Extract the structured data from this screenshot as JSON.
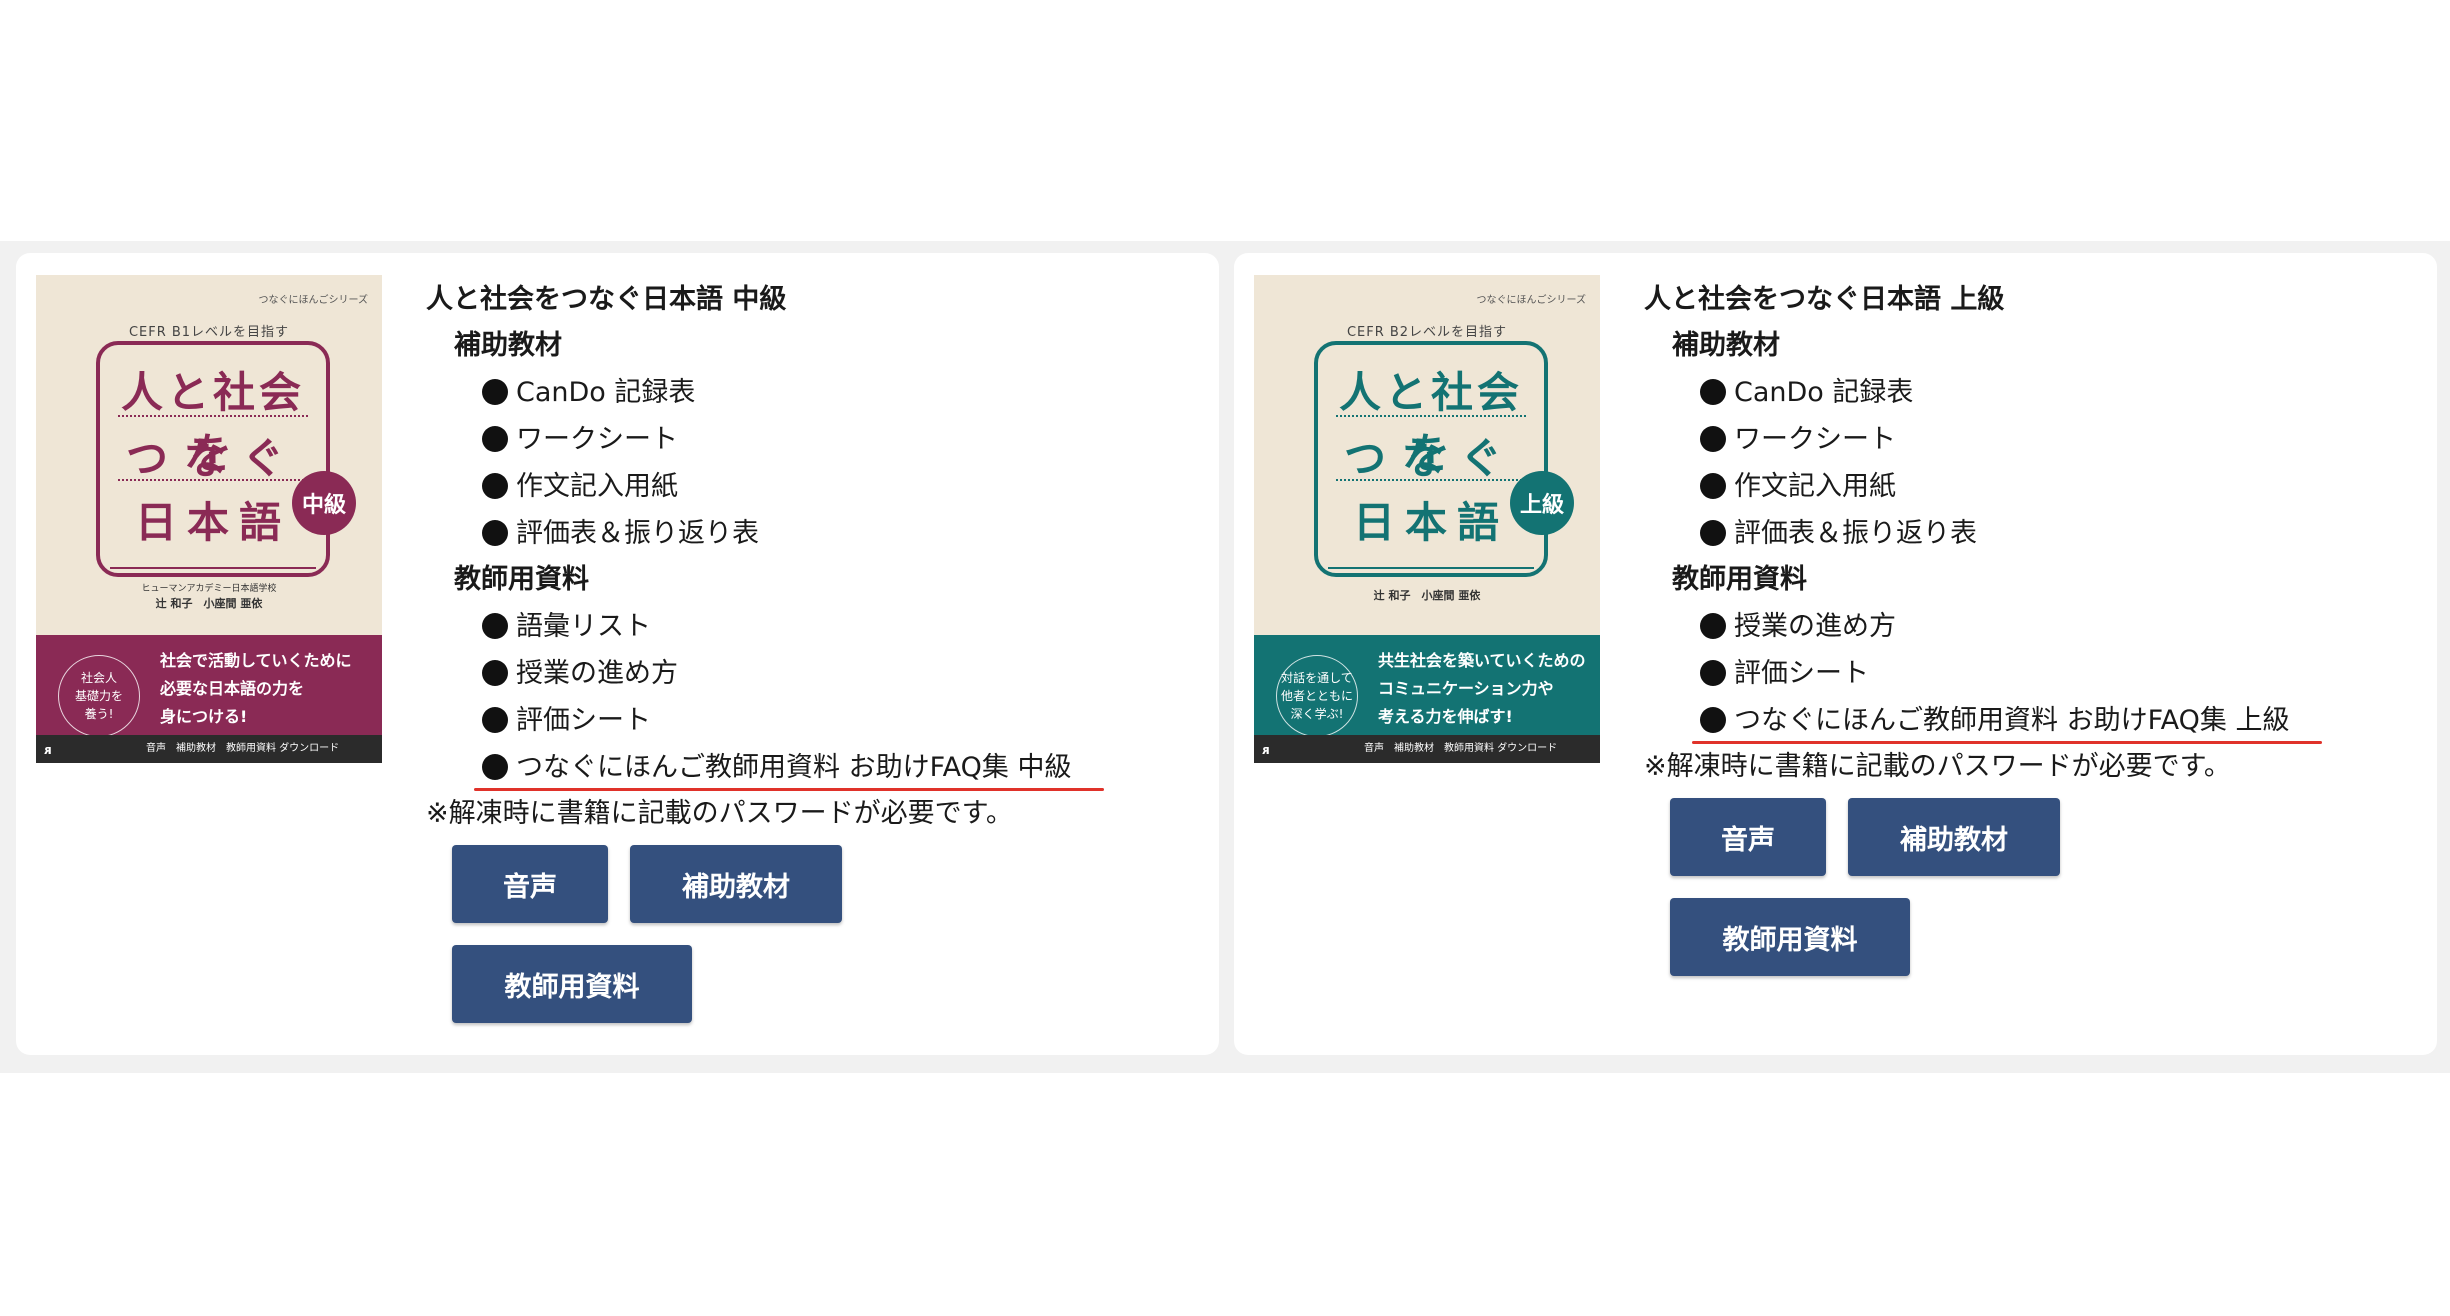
{
  "cards": [
    {
      "cover": {
        "series": "つなぐにほんごシリーズ",
        "cefr": "CEFR B1レベルを目指す",
        "title_line1": "人と社会を",
        "title_line2": "つなぐ",
        "title_line3": "日本語",
        "level_badge": "中級",
        "authors_org": "ヒューマンアカデミー日本語学校",
        "authors": "辻 和子　小座間 亜依",
        "circle_text": "社会人\n基礎力を\n養う!",
        "tagline": "社会で活動していくために\n必要な日本語の力を\n身につける!",
        "footer": "音声　補助教材　教師用資料 ダウンロード",
        "publisher": "ᴙ"
      },
      "title": "人と社会をつなぐ日本語 中級",
      "sections": [
        {
          "label": "補助教材",
          "items": [
            "CanDo 記録表",
            "ワークシート",
            "作文記入用紙",
            "評価表＆振り返り表"
          ]
        },
        {
          "label": "教師用資料",
          "items": [
            "語彙リスト",
            "授業の進め方",
            "評価シート",
            "つなぐにほんご教師用資料 お助けFAQ集 中級"
          ]
        }
      ],
      "note": "※解凍時に書籍に記載のパスワードが必要です。",
      "buttons": [
        "音声",
        "補助教材",
        "教師用資料"
      ]
    },
    {
      "cover": {
        "series": "つなぐにほんごシリーズ",
        "cefr": "CEFR B2レベルを目指す",
        "title_line1": "人と社会を",
        "title_line2": "つなぐ",
        "title_line3": "日本語",
        "level_badge": "上級",
        "authors_org": "",
        "authors": "辻 和子　小座間 亜依",
        "circle_text": "対話を通して\n他者とともに\n深く学ぶ!",
        "tagline": "共生社会を築いていくための\nコミュニケーション力や\n考える力を伸ばす!",
        "footer": "音声　補助教材　教師用資料 ダウンロード",
        "publisher": "ᴙ"
      },
      "title": "人と社会をつなぐ日本語 上級",
      "sections": [
        {
          "label": "補助教材",
          "items": [
            "CanDo 記録表",
            "ワークシート",
            "作文記入用紙",
            "評価表＆振り返り表"
          ]
        },
        {
          "label": "教師用資料",
          "items": [
            "授業の進め方",
            "評価シート",
            "つなぐにほんご教師用資料 お助けFAQ集 上級"
          ]
        }
      ],
      "note": "※解凍時に書籍に記載のパスワードが必要です。",
      "buttons": [
        "音声",
        "補助教材",
        "教師用資料"
      ]
    }
  ],
  "colors": {
    "button_bg": "#34507e",
    "intermediate_accent": "#8a2a55",
    "advanced_accent": "#137373",
    "underline": "#e0322a"
  }
}
